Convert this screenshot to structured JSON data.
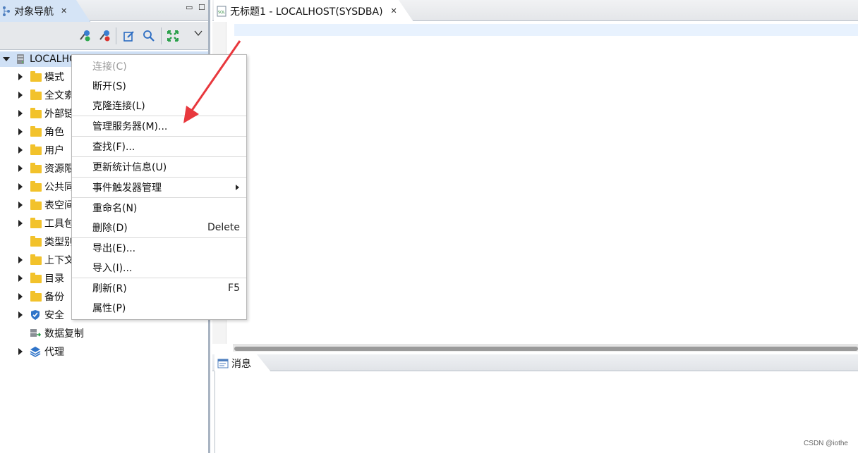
{
  "navigator": {
    "tab_label": "对象导航",
    "root_label": "LOCALHOST",
    "tree_items": [
      {
        "label": "模式",
        "expandable": true,
        "icon": "folder-icon"
      },
      {
        "label": "全文索",
        "expandable": true,
        "icon": "folder-icon"
      },
      {
        "label": "外部链",
        "expandable": true,
        "icon": "folder-icon"
      },
      {
        "label": "角色",
        "expandable": true,
        "icon": "folder-icon"
      },
      {
        "label": "用户",
        "expandable": true,
        "icon": "folder-icon"
      },
      {
        "label": "资源限",
        "expandable": true,
        "icon": "folder-icon"
      },
      {
        "label": "公共同",
        "expandable": true,
        "icon": "folder-icon"
      },
      {
        "label": "表空间",
        "expandable": true,
        "icon": "folder-icon"
      },
      {
        "label": "工具包",
        "expandable": true,
        "icon": "folder-icon"
      },
      {
        "label": "类型别",
        "expandable": false,
        "icon": "folder-icon"
      },
      {
        "label": "上下文",
        "expandable": true,
        "icon": "folder-icon"
      },
      {
        "label": "目录",
        "expandable": true,
        "icon": "folder-icon"
      },
      {
        "label": "备份",
        "expandable": true,
        "icon": "folder-icon"
      },
      {
        "label": "安全",
        "expandable": true,
        "icon": "shield-icon"
      },
      {
        "label": "数据复制",
        "expandable": false,
        "icon": "replication-icon"
      },
      {
        "label": "代理",
        "expandable": true,
        "icon": "layers-icon"
      }
    ]
  },
  "editor": {
    "tab_label": "无标题1 - LOCALHOST(SYSDBA)"
  },
  "messages": {
    "tab_label": "消息"
  },
  "context_menu": {
    "items": [
      {
        "label": "连接(C)",
        "accel": "",
        "disabled": true
      },
      {
        "label": "断开(S)",
        "accel": "",
        "disabled": false
      },
      {
        "label": "克隆连接(L)",
        "accel": "",
        "disabled": false
      },
      {
        "label": "管理服务器(M)...",
        "accel": "",
        "disabled": false
      },
      {
        "label": "查找(F)...",
        "accel": "",
        "disabled": false
      },
      {
        "label": "更新统计信息(U)",
        "accel": "",
        "disabled": false
      },
      {
        "label": "事件触发器管理",
        "accel": "",
        "disabled": false,
        "submenu": true
      },
      {
        "label": "重命名(N)",
        "accel": "",
        "disabled": false
      },
      {
        "label": "删除(D)",
        "accel": "Delete",
        "disabled": false
      },
      {
        "label": "导出(E)...",
        "accel": "",
        "disabled": false
      },
      {
        "label": "导入(I)...",
        "accel": "",
        "disabled": false
      },
      {
        "label": "刷新(R)",
        "accel": "F5",
        "disabled": false
      },
      {
        "label": "属性(P)",
        "accel": "",
        "disabled": false
      }
    ]
  },
  "watermark": "CSDN @iothe",
  "colors": {
    "accent_arrow": "#e8383d",
    "selection": "#cfe0f5",
    "folder": "#f2c22b"
  }
}
